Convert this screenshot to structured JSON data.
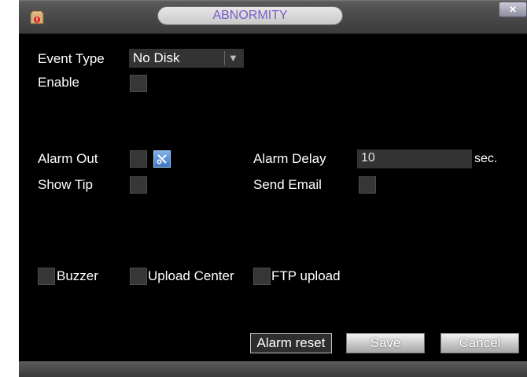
{
  "window": {
    "title": "ABNORMITY",
    "close_icon": "close-icon",
    "app_icon": "warning-app-icon"
  },
  "form": {
    "event_type": {
      "label": "Event Type",
      "value": "No Disk"
    },
    "enable": {
      "label": "Enable",
      "checked": false
    },
    "alarm_out": {
      "label": "Alarm Out",
      "checked": false,
      "setup_icon": "setup-icon"
    },
    "alarm_delay": {
      "label": "Alarm Delay",
      "value": "10",
      "unit": "sec."
    },
    "show_tip": {
      "label": "Show Tip",
      "checked": false
    },
    "send_email": {
      "label": "Send Email",
      "checked": false
    },
    "buzzer": {
      "label": "Buzzer",
      "checked": false
    },
    "upload_center": {
      "label": "Upload Center",
      "checked": false
    },
    "ftp_upload": {
      "label": "FTP upload",
      "checked": false
    }
  },
  "buttons": {
    "alarm_reset": "Alarm reset",
    "save": "Save",
    "cancel": "Cancel"
  }
}
